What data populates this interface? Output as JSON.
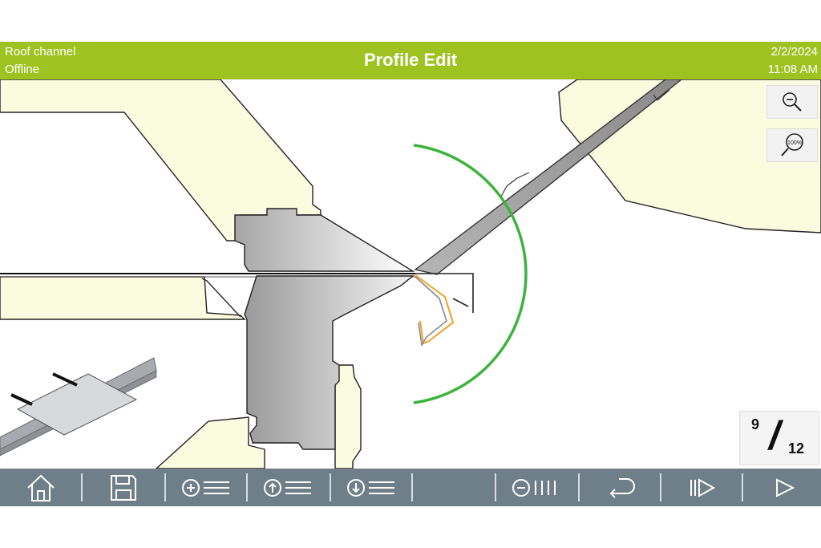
{
  "header": {
    "profile_name": "Roof channel",
    "connection_status": "Offline",
    "title": "Profile Edit",
    "date": "2/2/2024",
    "time": "11:08 AM"
  },
  "zoom_controls": {
    "zoom_out_icon": "zoom-out-magnifier",
    "zoom_reset_icon": "zoom-100-magnifier",
    "zoom_reset_label": "100%"
  },
  "bend_counter": {
    "current": "9",
    "separator": "/",
    "total": "12"
  },
  "toolbar": {
    "icons": [
      "home-icon",
      "save-icon",
      "add-bend-icon",
      "move-bend-up-icon",
      "move-bend-down-icon",
      "empty-slot",
      "remove-bends-icon",
      "undo-icon",
      "step-forward-icon",
      "play-icon"
    ]
  },
  "colors": {
    "header_green": "#9ec321",
    "toolbar_gray": "#6f7f8a",
    "tool_cream": "#fbfbe0",
    "bend_arc_green": "#3cb43c",
    "part_orange": "#f0a020"
  }
}
